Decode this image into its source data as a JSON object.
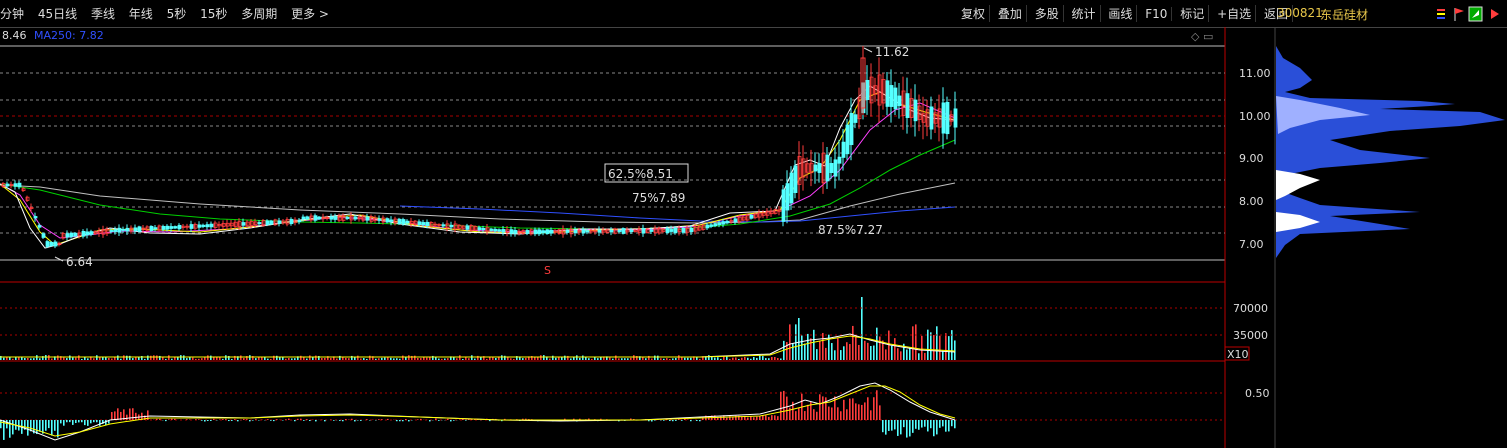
{
  "toolbar": {
    "left_items": [
      "分钟",
      "45日线",
      "季线",
      "年线",
      "5秒",
      "15秒",
      "多周期",
      "更多 >"
    ],
    "right_items": [
      "复权",
      "叠加",
      "多股",
      "统计",
      "画线",
      "F10",
      "标记",
      "+自选",
      "返回"
    ]
  },
  "stock": {
    "code": "300821",
    "name": "东岳硅材"
  },
  "ma_row": {
    "first": "8.46",
    "ma250": "MA250: 7.82"
  },
  "price_axis": {
    "labels": [
      "11.00",
      "10.00",
      "9.00",
      "8.00",
      "7.00"
    ]
  },
  "annotations": {
    "high": "11.62",
    "low": "6.64",
    "fib_625": "62.5%8.51",
    "fib_75": "75%7.89",
    "fib_875": "87.5%7.27",
    "marker": "S"
  },
  "volume_axis": {
    "labels": [
      "70000",
      "35000"
    ],
    "unit": "X10"
  },
  "macd_axis": {
    "labels": [
      "0.50"
    ]
  },
  "colors": {
    "up": "#ff3c3c",
    "down": "#54ffff",
    "ma5": "#ffffff",
    "ma10": "#ffff00",
    "ma20": "#ff40ff",
    "ma60": "#00d000",
    "ma120": "#c0c0c0",
    "ma250": "#3050ff",
    "profile": "#2a4fd8",
    "code": "#e8c74a"
  }
}
